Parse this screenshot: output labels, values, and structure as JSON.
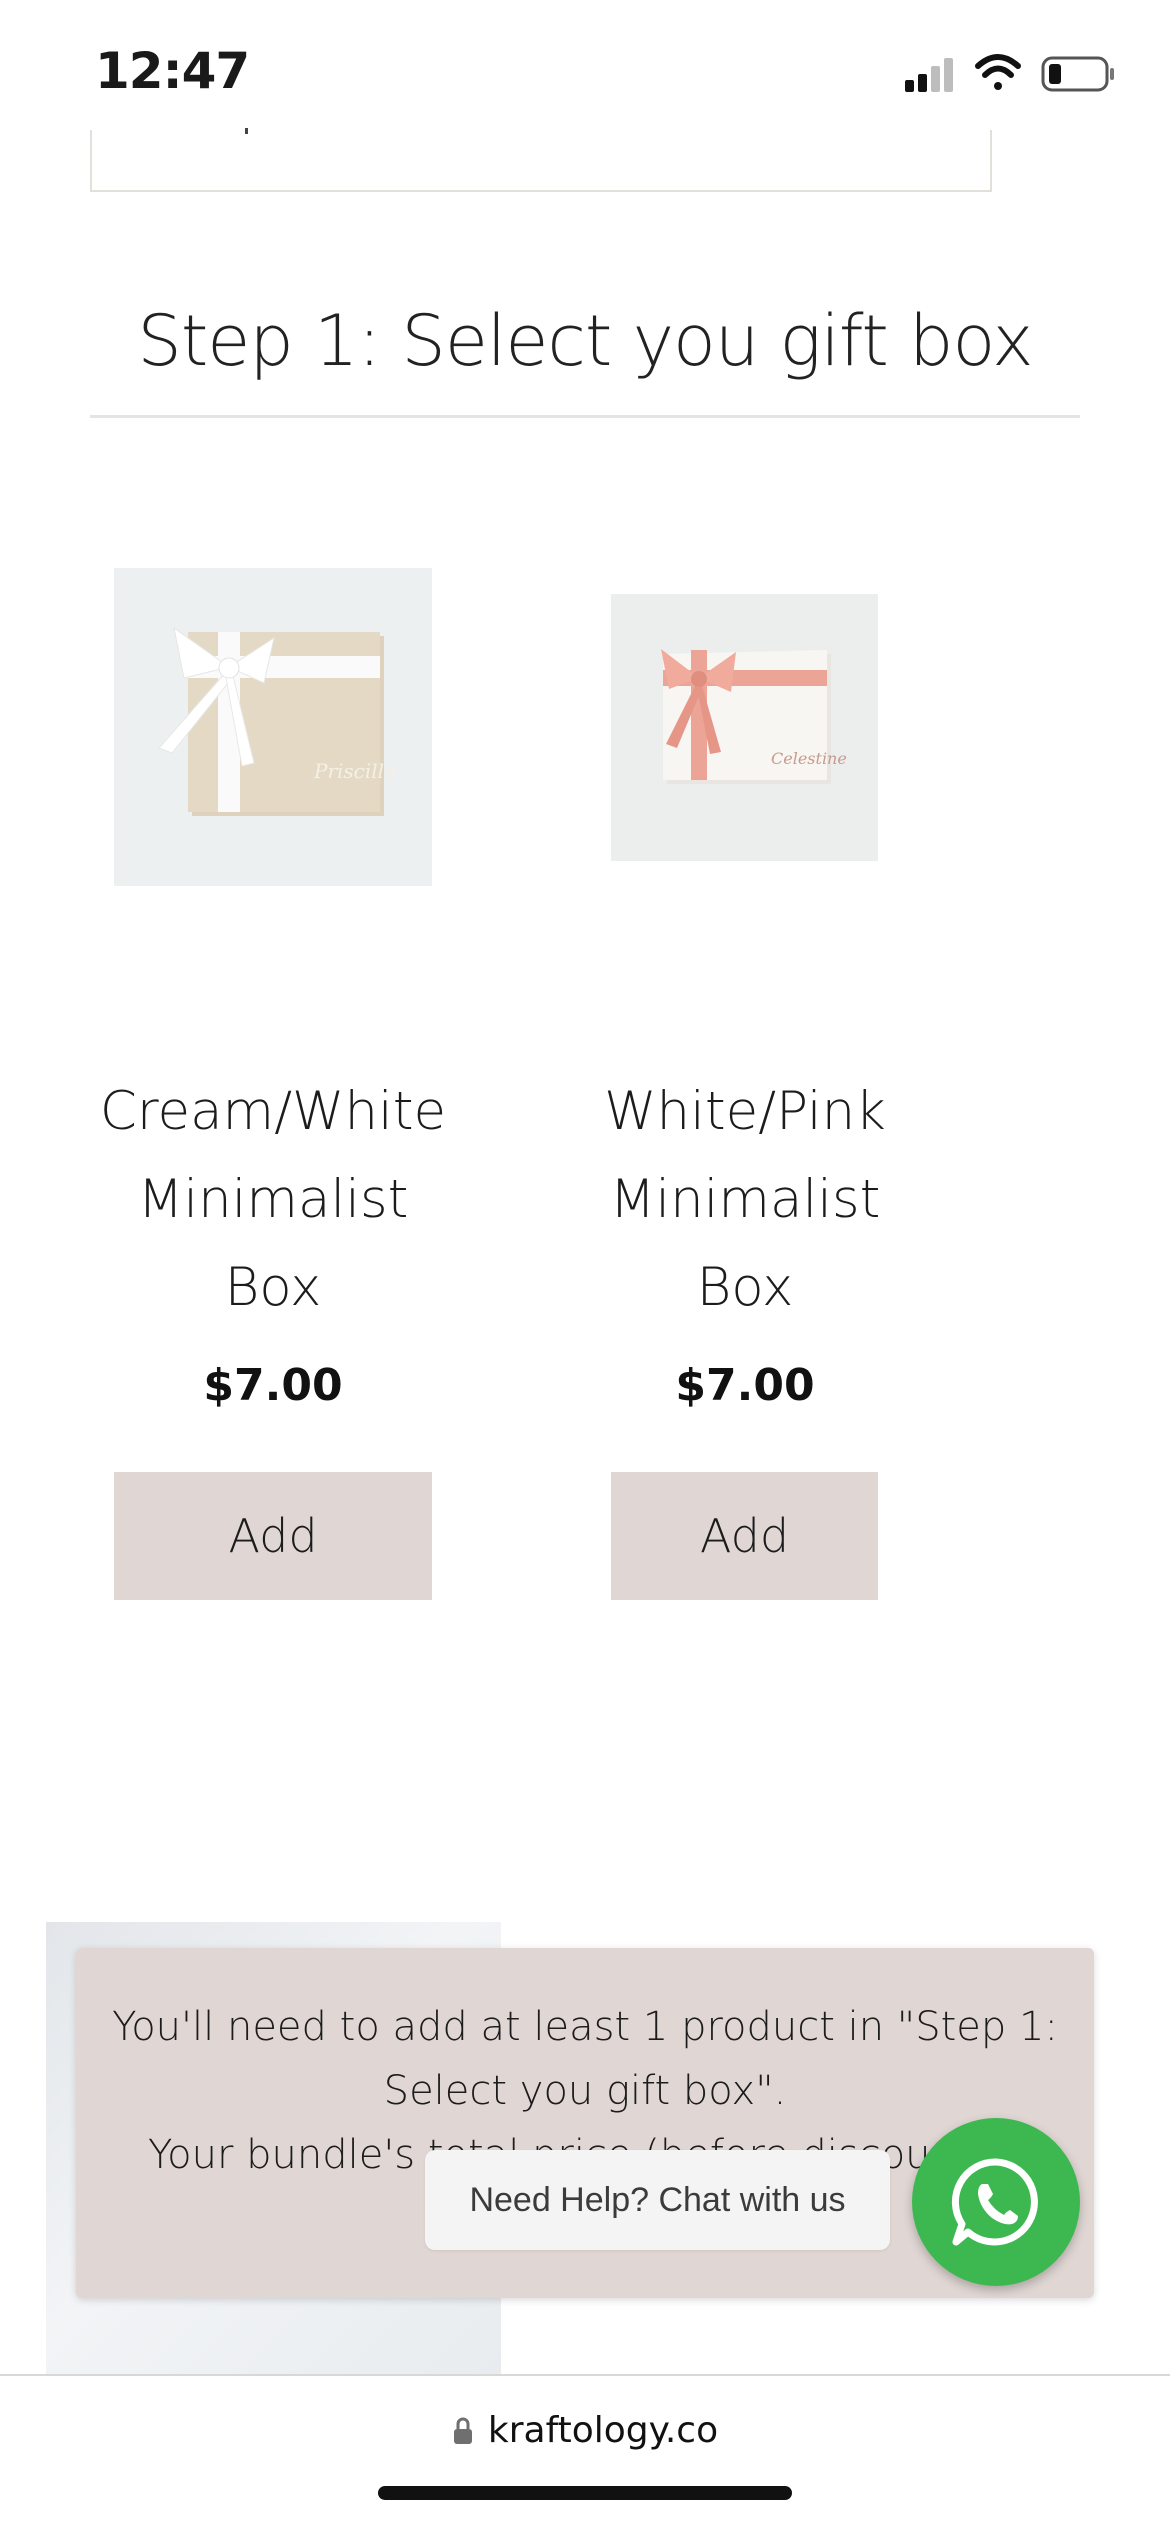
{
  "status_bar": {
    "time": "12:47",
    "icons": [
      "cellular-signal-icon",
      "wifi-icon",
      "battery-icon"
    ]
  },
  "section": {
    "heading": "Step 1: Select you gift box"
  },
  "products": [
    {
      "name_lines": [
        "Cream/White",
        "Minimalist",
        "Box"
      ],
      "price": "$7.00",
      "button_label": "Add",
      "image_script_text": "Priscilla",
      "ribbon_color": "#ffffff",
      "box_color": "#e2d7c2"
    },
    {
      "name_lines": [
        "White/Pink",
        "Minimalist",
        "Box"
      ],
      "price": "$7.00",
      "button_label": "Add",
      "image_script_text": "Celestine",
      "ribbon_color": "#e9a393",
      "box_color": "#f6f4f1"
    }
  ],
  "notice": {
    "line1": "You'll need to add at least 1 product in \"Step 1:",
    "line2": "Select you gift box\".",
    "line3": "Your bundle's total price (before discount)"
  },
  "chat": {
    "label": "Need Help? Chat with us",
    "icon": "whatsapp-icon",
    "color": "#3db850"
  },
  "browser": {
    "url": "kraftology.co",
    "icon": "lock-icon"
  },
  "colors": {
    "button_bg": "#e0d7d4",
    "divider": "#e6e3e0"
  }
}
